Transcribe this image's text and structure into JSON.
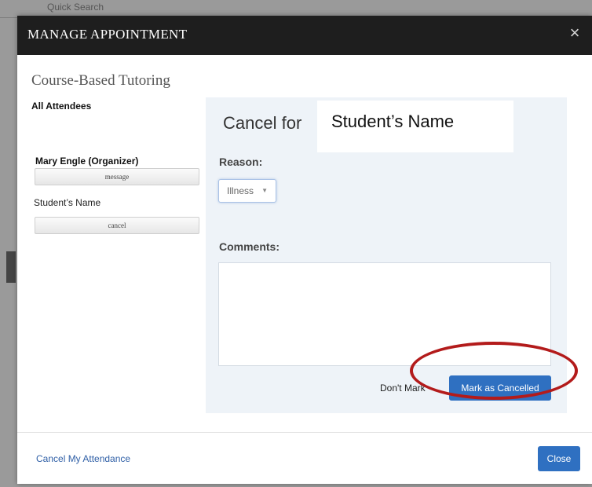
{
  "background": {
    "search_text": "Quick Search"
  },
  "modal": {
    "title": "MANAGE APPOINTMENT",
    "close_glyph": "×",
    "service_title": "Course-Based Tutoring"
  },
  "attendees": {
    "heading": "All Attendees",
    "organizer_name": "Mary Engle (Organizer)",
    "message_label": "message",
    "student_name": "Student’s Name",
    "cancel_label": "cancel"
  },
  "cancel_panel": {
    "cancel_for_label": "Cancel for",
    "student_name": "Student’s Name",
    "reason_label": "Reason:",
    "reason_value": "Illness",
    "caret_glyph": "▼",
    "comments_label": "Comments:",
    "comments_value": "",
    "dont_mark_label": "Don't Mark",
    "mark_cancelled_label": "Mark as Cancelled"
  },
  "footer": {
    "cancel_attendance_label": "Cancel My Attendance",
    "close_label": "Close"
  },
  "colors": {
    "header_bg": "#1e1e1e",
    "primary_button": "#2f70c1",
    "link": "#2f5fa6",
    "highlight_ring": "#b31b1b",
    "panel_bg": "#eef3f8"
  }
}
